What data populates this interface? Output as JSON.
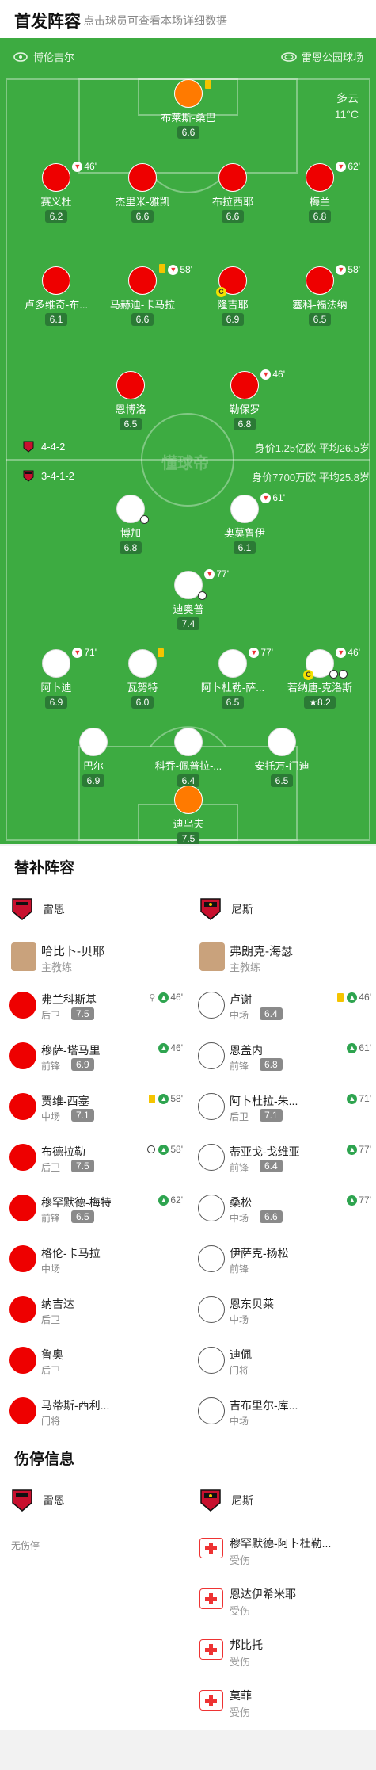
{
  "header": {
    "title": "首发阵容",
    "hint": "点击球员可查看本场详细数据"
  },
  "pitch": {
    "home_team": "博伦吉尔",
    "away_team": "雷恩公园球场",
    "weather": "多云",
    "temperature": "11°C",
    "watermark": "懂球帝",
    "home_formation": "4-4-2",
    "home_value": "身价1.25亿欧  平均26.5岁",
    "away_formation": "3-4-1-2",
    "away_value": "身价7700万欧  平均25.8岁",
    "colors": {
      "home": "#ee0000",
      "away": "#ffffff",
      "keeper": "#ff7a00",
      "pitch": "#3dab41"
    }
  },
  "home_players": [
    {
      "name": "布莱斯-桑巴",
      "rating": "6.6",
      "color": "orange"
    },
    {
      "name": "赛义杜",
      "rating": "6.2",
      "sub": "46'"
    },
    {
      "name": "杰里米-雅凯",
      "rating": "6.6"
    },
    {
      "name": "布拉西耶",
      "rating": "6.6"
    },
    {
      "name": "梅兰",
      "rating": "6.8",
      "sub": "62'"
    },
    {
      "name": "卢多维奇-布...",
      "rating": "6.1"
    },
    {
      "name": "马赫迪-卡马拉",
      "rating": "6.6",
      "sub": "58'"
    },
    {
      "name": "隆吉耶",
      "rating": "6.9"
    },
    {
      "name": "塞科-福法纳",
      "rating": "6.5",
      "sub": "58'"
    },
    {
      "name": "恩博洛",
      "rating": "6.5"
    },
    {
      "name": "勒保罗",
      "rating": "6.8",
      "sub": "46'"
    }
  ],
  "away_players": [
    {
      "name": "博加",
      "rating": "6.8"
    },
    {
      "name": "奥莫鲁伊",
      "rating": "6.1",
      "sub": "61'"
    },
    {
      "name": "迪奥普",
      "rating": "7.4",
      "sub": "77'"
    },
    {
      "name": "阿卜迪",
      "rating": "6.9",
      "sub": "71'"
    },
    {
      "name": "瓦努特",
      "rating": "6.0"
    },
    {
      "name": "阿卜杜勒-萨...",
      "rating": "6.5",
      "sub": "77'"
    },
    {
      "name": "若纳唐-克洛斯",
      "rating": "8.2",
      "sub": "46'"
    },
    {
      "name": "巴尔",
      "rating": "6.9"
    },
    {
      "name": "科乔-佩普拉-...",
      "rating": "6.4"
    },
    {
      "name": "安托万-门迪",
      "rating": "6.5"
    },
    {
      "name": "迪乌夫",
      "rating": "7.5",
      "color": "orange"
    }
  ],
  "subs": {
    "title": "替补阵容",
    "home_team": "雷恩",
    "away_team": "尼斯",
    "home_coach": {
      "name": "哈比卜-贝耶",
      "role": "主教练"
    },
    "away_coach": {
      "name": "弗朗克-海瑟",
      "role": "主教练"
    },
    "home": [
      {
        "name": "弗兰科斯基",
        "pos": "后卫",
        "rating": "7.5",
        "minute": "46'"
      },
      {
        "name": "穆萨-塔马里",
        "pos": "前锋",
        "rating": "6.9",
        "minute": "46'"
      },
      {
        "name": "贾维-西塞",
        "pos": "中场",
        "rating": "7.1",
        "minute": "58'"
      },
      {
        "name": "布德拉勒",
        "pos": "后卫",
        "rating": "7.5",
        "minute": "58'"
      },
      {
        "name": "穆罕默德-梅特",
        "pos": "前锋",
        "rating": "6.5",
        "minute": "62'"
      },
      {
        "name": "格伦-卡马拉",
        "pos": "中场"
      },
      {
        "name": "纳吉达",
        "pos": "后卫"
      },
      {
        "name": "鲁奥",
        "pos": "后卫"
      },
      {
        "name": "马蒂斯-西利...",
        "pos": "门将"
      }
    ],
    "away": [
      {
        "name": "卢谢",
        "pos": "中场",
        "rating": "6.4",
        "minute": "46'"
      },
      {
        "name": "恩盖内",
        "pos": "前锋",
        "rating": "6.8",
        "minute": "61'"
      },
      {
        "name": "阿卜杜拉-朱...",
        "pos": "后卫",
        "rating": "7.1",
        "minute": "71'"
      },
      {
        "name": "蒂亚戈-戈维亚",
        "pos": "前锋",
        "rating": "6.4",
        "minute": "77'"
      },
      {
        "name": "桑松",
        "pos": "中场",
        "rating": "6.6",
        "minute": "77'"
      },
      {
        "name": "伊萨克-扬松",
        "pos": "前锋"
      },
      {
        "name": "恩东贝莱",
        "pos": "中场"
      },
      {
        "name": "迪佩",
        "pos": "门将"
      },
      {
        "name": "吉布里尔-库...",
        "pos": "中场"
      }
    ]
  },
  "injuries": {
    "title": "伤停信息",
    "home_team": "雷恩",
    "away_team": "尼斯",
    "home_none": "无伤停",
    "away": [
      {
        "name": "穆罕默德-阿卜杜勒...",
        "status": "受伤"
      },
      {
        "name": "恩达伊希米耶",
        "status": "受伤"
      },
      {
        "name": "邦比托",
        "status": "受伤"
      },
      {
        "name": "莫菲",
        "status": "受伤"
      }
    ]
  }
}
